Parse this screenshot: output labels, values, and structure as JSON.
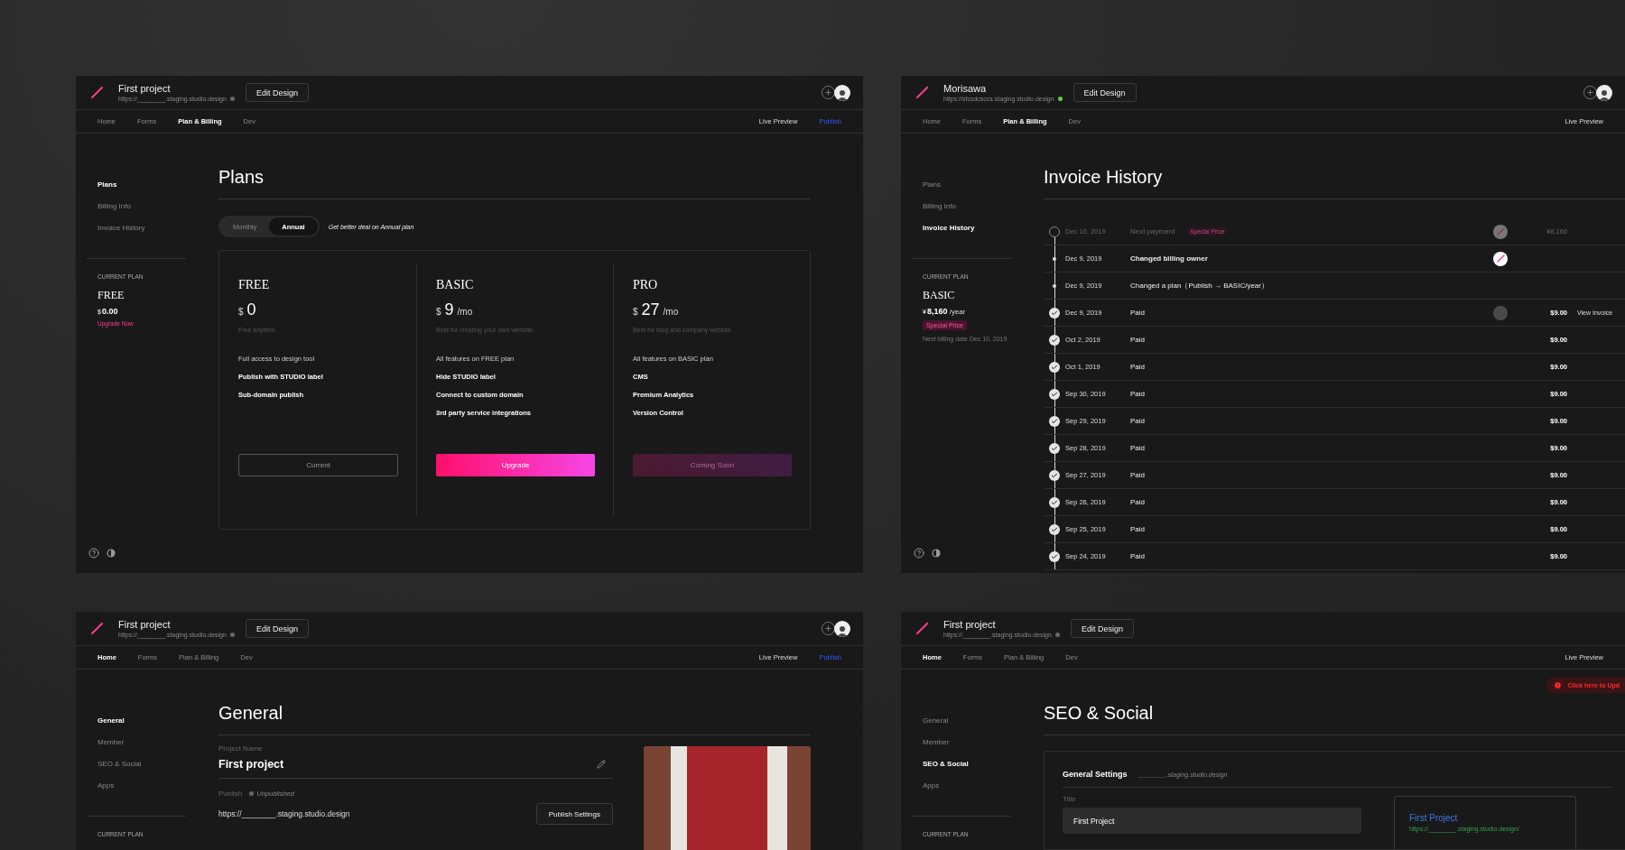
{
  "windows": [
    {
      "kind": "plans",
      "project": "First project",
      "url": "https://________.staging.studio.design",
      "published": false,
      "edit_button": "Edit Design",
      "collaborators": true,
      "nav": [
        {
          "label": "Home",
          "selected": false
        },
        {
          "label": "Forms",
          "selected": false
        },
        {
          "label": "Plan & Billing",
          "selected": true
        },
        {
          "label": "Dev",
          "selected": false
        }
      ],
      "nav_right": [
        {
          "label": "Live Preview",
          "kind": "preview"
        },
        {
          "label": "Publish",
          "kind": "publish"
        }
      ],
      "sidebar": [
        {
          "label": "Plans",
          "selected": true
        },
        {
          "label": "Billing Info",
          "selected": false
        },
        {
          "label": "Invoice History",
          "selected": false
        }
      ],
      "current_plan": {
        "label": "CURRENT PLAN",
        "name": "FREE",
        "currency": "$",
        "amount": "0.00",
        "link": "Upgrade Now"
      },
      "footer": true,
      "title": "Plans",
      "toggle": [
        {
          "label": "Monthly",
          "selected": false
        },
        {
          "label": "Annual",
          "selected": true
        }
      ],
      "toggle_hint": "Get better deal on Annual plan",
      "plans": [
        {
          "name": "FREE",
          "currency": "$",
          "price": "0",
          "description": "Free anytime.",
          "features": [
            {
              "text": "Full access to design tool",
              "highlighted": false
            },
            {
              "text": "Publish with STUDIO label",
              "highlighted": true
            },
            {
              "text": "Sub-domain publish",
              "highlighted": true
            }
          ],
          "button": {
            "label": "Current",
            "kind": "outline"
          }
        },
        {
          "name": "BASIC",
          "currency": "$",
          "price": "9",
          "unit": "/mo",
          "description": "Best for creating your own website.",
          "features": [
            {
              "text": "All features on FREE plan",
              "highlighted": false
            },
            {
              "text": "Hide STUDIO label",
              "highlighted": true
            },
            {
              "text": "Connect to custom domain",
              "highlighted": true
            },
            {
              "text": "3rd party service integrations",
              "highlighted": true
            }
          ],
          "button": {
            "label": "Upgrade",
            "kind": "primary"
          }
        },
        {
          "name": "PRO",
          "currency": "$",
          "price": "27",
          "unit": "/mo",
          "description": "Best for blog and company website.",
          "features": [
            {
              "text": "All features on BASIC plan",
              "highlighted": false
            },
            {
              "text": "CMS",
              "highlighted": true
            },
            {
              "text": "Premium Analytics",
              "highlighted": true
            },
            {
              "text": "Version Control",
              "highlighted": true
            }
          ],
          "button": {
            "label": "Coming Soon",
            "kind": "disabled"
          }
        }
      ]
    },
    {
      "kind": "invoices",
      "project": "Morisawa",
      "url": "https://sfcsdcsccs.staging.studio.design",
      "published": true,
      "edit_button": "Edit Design",
      "collaborators": true,
      "nav": [
        {
          "label": "Home",
          "selected": false
        },
        {
          "label": "Forms",
          "selected": false
        },
        {
          "label": "Plan & Billing",
          "selected": true
        },
        {
          "label": "Dev",
          "selected": false
        }
      ],
      "nav_right": [
        {
          "label": "Live Preview",
          "kind": "preview"
        }
      ],
      "sidebar": [
        {
          "label": "Plans",
          "selected": false
        },
        {
          "label": "Billing Info",
          "selected": false
        },
        {
          "label": "Invoice History",
          "selected": true
        }
      ],
      "current_plan": {
        "label": "CURRENT PLAN",
        "name": "BASIC",
        "currency": "¥",
        "amount": "8,160",
        "unit": "/year",
        "badge": "Special Price",
        "note": "Next billing date Dec 10, 2019"
      },
      "footer": true,
      "title": "Invoice History",
      "rows": [
        {
          "kind": "upcoming",
          "date": "Dec 10, 2019",
          "event": "Next payment",
          "badge": "Special Price",
          "avatar": {
            "kind": "logo",
            "muted": true
          },
          "amount": "¥8,160"
        },
        {
          "kind": "event",
          "date": "Dec 9, 2019",
          "event": "Changed billing owner",
          "highlighted": true,
          "avatar": {
            "kind": "logo",
            "muted": false
          }
        },
        {
          "kind": "event",
          "date": "Dec 9, 2019",
          "event": "Changed a plan（Publish → BASIC/year）",
          "highlighted": false
        },
        {
          "kind": "paid",
          "date": "Dec 9, 2019",
          "event": "Paid",
          "avatar": {
            "kind": "blank",
            "muted": false
          },
          "amount": "$9.00",
          "action": "View Invoice"
        },
        {
          "kind": "paid",
          "date": "Oct 2, 2019",
          "event": "Paid",
          "amount": "$9.00"
        },
        {
          "kind": "paid",
          "date": "Oct 1, 2019",
          "event": "Paid",
          "amount": "$9.00"
        },
        {
          "kind": "paid",
          "date": "Sep 30, 2019",
          "event": "Paid",
          "amount": "$9.00"
        },
        {
          "kind": "paid",
          "date": "Sep 29, 2019",
          "event": "Paid",
          "amount": "$9.00"
        },
        {
          "kind": "paid",
          "date": "Sep 28, 2019",
          "event": "Paid",
          "amount": "$9.00"
        },
        {
          "kind": "paid",
          "date": "Sep 27, 2019",
          "event": "Paid",
          "amount": "$9.00"
        },
        {
          "kind": "paid",
          "date": "Sep 26, 2019",
          "event": "Paid",
          "amount": "$9.00"
        },
        {
          "kind": "paid",
          "date": "Sep 25, 2019",
          "event": "Paid",
          "amount": "$9.00"
        },
        {
          "kind": "paid",
          "date": "Sep 24, 2019",
          "event": "Paid",
          "amount": "$9.00"
        }
      ]
    },
    {
      "kind": "general",
      "project": "First project",
      "url": "https://________.staging.studio.design",
      "published": false,
      "edit_button": "Edit Design",
      "collaborators": true,
      "nav": [
        {
          "label": "Home",
          "selected": true
        },
        {
          "label": "Forms",
          "selected": false
        },
        {
          "label": "Plan & Billing",
          "selected": false
        },
        {
          "label": "Dev",
          "selected": false
        }
      ],
      "nav_right": [
        {
          "label": "Live Preview",
          "kind": "preview"
        },
        {
          "label": "Publish",
          "kind": "publish"
        }
      ],
      "sidebar": [
        {
          "label": "General",
          "selected": true
        },
        {
          "label": "Member",
          "selected": false
        },
        {
          "label": "SEO & Social",
          "selected": false
        },
        {
          "label": "Apps",
          "selected": false
        }
      ],
      "current_plan": {
        "label": "CURRENT PLAN"
      },
      "footer": false,
      "title": "General",
      "name_label": "Project Name",
      "name_value": "First project",
      "publish_label": "Publish",
      "publish_status": "Unpublished",
      "site_url": "https://________.staging.studio.design",
      "settings_button": "Publish Settings"
    },
    {
      "kind": "seo",
      "project": "First project",
      "url": "https://________.staging.studio.design",
      "published": false,
      "edit_button": "Edit Design",
      "collaborators": false,
      "nav": [
        {
          "label": "Home",
          "selected": true
        },
        {
          "label": "Forms",
          "selected": false
        },
        {
          "label": "Plan & Billing",
          "selected": false
        },
        {
          "label": "Dev",
          "selected": false
        }
      ],
      "nav_right": [
        {
          "label": "Live Preview",
          "kind": "preview"
        }
      ],
      "sidebar": [
        {
          "label": "General",
          "selected": false
        },
        {
          "label": "Member",
          "selected": false
        },
        {
          "label": "SEO & Social",
          "selected": true
        },
        {
          "label": "Apps",
          "selected": false
        }
      ],
      "current_plan": {
        "label": "CURRENT PLAN"
      },
      "footer": false,
      "alert": "Click here to Upd",
      "title": "SEO & Social",
      "section_title": "General Settings",
      "section_domain": "________.staging.studio.design",
      "field_label": "Title",
      "field_value": "First Project",
      "preview_title": "First Project",
      "preview_url": "https://________.staging.studio.design/"
    }
  ]
}
